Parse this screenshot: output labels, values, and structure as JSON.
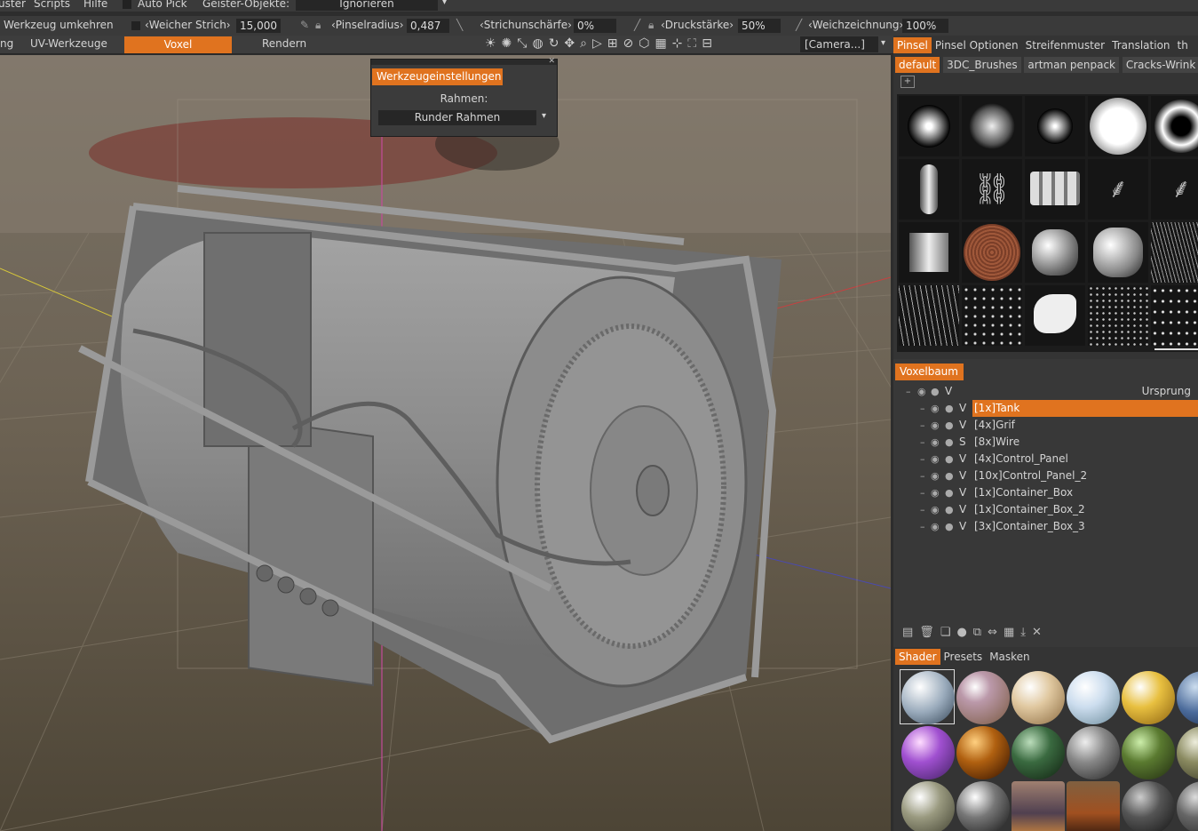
{
  "menu": {
    "items": [
      "uster",
      "Scripts",
      "Hilfe"
    ],
    "auto_pick": "Auto Pick",
    "ghost_label": "Geister-Objekte:",
    "ghost_value": "Ignorieren"
  },
  "toolbar": {
    "invert_tool": "Werkzeug umkehren",
    "soft_stroke": "‹Weicher Strich›",
    "soft_stroke_value": "15,000",
    "brush_radius": "‹Pinselradius›",
    "brush_radius_value": "0,487",
    "stroke_sharpness": "‹Strichunschärfe›",
    "stroke_sharpness_value": "0%",
    "pressure": "‹Druckstärke›",
    "pressure_value": "50%",
    "smoothing": "‹Weichzeichnung›",
    "smoothing_value": "100%"
  },
  "rooms": {
    "items": [
      "ng",
      "UV-Werkzeuge",
      "Voxel",
      "Rendern"
    ],
    "active": "Voxel",
    "camera": "[Camera...]"
  },
  "tool_settings": {
    "title": "Werkzeugeinstellungen",
    "frame_label": "Rahmen:",
    "frame_value": "Runder Rahmen"
  },
  "brush_panel": {
    "tabs": [
      "Pinsel",
      "Pinsel Optionen",
      "Streifenmuster",
      "Translation",
      "th"
    ],
    "packs": [
      "default",
      "3DC_Brushes",
      "artman penpack",
      "Cracks-Wrink"
    ]
  },
  "voxel_tree": {
    "title": "Voxelbaum",
    "root": {
      "label": "Ursprung",
      "type": "V"
    },
    "items": [
      {
        "label": "[1x]Tank",
        "type": "V",
        "selected": true
      },
      {
        "label": "[4x]Grif",
        "type": "V"
      },
      {
        "label": "[8x]Wire",
        "type": "S"
      },
      {
        "label": "[4x]Control_Panel",
        "type": "V"
      },
      {
        "label": "[10x]Control_Panel_2",
        "type": "V"
      },
      {
        "label": "[1x]Container_Box",
        "type": "V"
      },
      {
        "label": "[1x]Container_Box_2",
        "type": "V"
      },
      {
        "label": "[3x]Container_Box_3",
        "type": "V"
      }
    ]
  },
  "shader_panel": {
    "tabs": [
      "Shader",
      "Presets",
      "Masken"
    ]
  },
  "colors": {
    "accent": "#e0731f",
    "panel": "#343434",
    "ground": "#4d4536"
  }
}
